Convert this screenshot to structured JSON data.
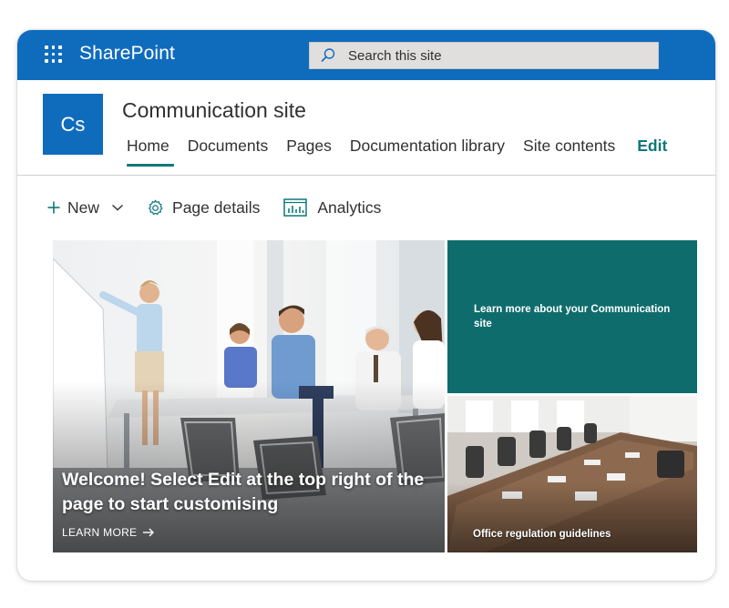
{
  "suitebar": {
    "app_name": "SharePoint",
    "search_placeholder": "Search this site",
    "brand_color": "#0f6cbd",
    "icons": [
      "waffle-icon",
      "search-icon"
    ]
  },
  "site": {
    "logo_initials": "Cs",
    "title": "Communication site",
    "nav": [
      {
        "label": "Home",
        "active": true
      },
      {
        "label": "Documents",
        "active": false
      },
      {
        "label": "Pages",
        "active": false
      },
      {
        "label": "Documentation library",
        "active": false
      },
      {
        "label": "Site contents",
        "active": false
      }
    ],
    "edit_label": "Edit",
    "accent_color": "#0e7878"
  },
  "commands": {
    "new_label": "New",
    "page_details_label": "Page details",
    "analytics_label": "Analytics",
    "icons": [
      "plus-icon",
      "chevron-down-icon",
      "gear-icon",
      "analytics-icon"
    ]
  },
  "hero": {
    "main_title": "Welcome! Select Edit at the top right of the page to start customising",
    "learn_more_label": "LEARN MORE",
    "tile_top_text": "Learn more about your Communication site",
    "tile_top_color": "#0f6c6c",
    "tile_bottom_caption": "Office regulation guidelines"
  }
}
